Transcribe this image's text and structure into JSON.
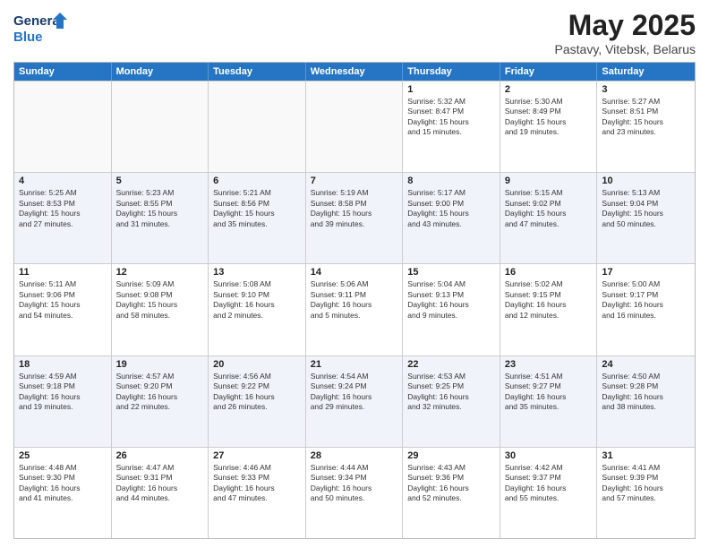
{
  "logo": {
    "line1": "General",
    "line2": "Blue"
  },
  "title": "May 2025",
  "subtitle": "Pastavy, Vitebsk, Belarus",
  "weekdays": [
    "Sunday",
    "Monday",
    "Tuesday",
    "Wednesday",
    "Thursday",
    "Friday",
    "Saturday"
  ],
  "rows": [
    [
      {
        "day": "",
        "text": "",
        "empty": true
      },
      {
        "day": "",
        "text": "",
        "empty": true
      },
      {
        "day": "",
        "text": "",
        "empty": true
      },
      {
        "day": "",
        "text": "",
        "empty": true
      },
      {
        "day": "1",
        "text": "Sunrise: 5:32 AM\nSunset: 8:47 PM\nDaylight: 15 hours\nand 15 minutes."
      },
      {
        "day": "2",
        "text": "Sunrise: 5:30 AM\nSunset: 8:49 PM\nDaylight: 15 hours\nand 19 minutes."
      },
      {
        "day": "3",
        "text": "Sunrise: 5:27 AM\nSunset: 8:51 PM\nDaylight: 15 hours\nand 23 minutes."
      }
    ],
    [
      {
        "day": "4",
        "text": "Sunrise: 5:25 AM\nSunset: 8:53 PM\nDaylight: 15 hours\nand 27 minutes."
      },
      {
        "day": "5",
        "text": "Sunrise: 5:23 AM\nSunset: 8:55 PM\nDaylight: 15 hours\nand 31 minutes."
      },
      {
        "day": "6",
        "text": "Sunrise: 5:21 AM\nSunset: 8:56 PM\nDaylight: 15 hours\nand 35 minutes."
      },
      {
        "day": "7",
        "text": "Sunrise: 5:19 AM\nSunset: 8:58 PM\nDaylight: 15 hours\nand 39 minutes."
      },
      {
        "day": "8",
        "text": "Sunrise: 5:17 AM\nSunset: 9:00 PM\nDaylight: 15 hours\nand 43 minutes."
      },
      {
        "day": "9",
        "text": "Sunrise: 5:15 AM\nSunset: 9:02 PM\nDaylight: 15 hours\nand 47 minutes."
      },
      {
        "day": "10",
        "text": "Sunrise: 5:13 AM\nSunset: 9:04 PM\nDaylight: 15 hours\nand 50 minutes."
      }
    ],
    [
      {
        "day": "11",
        "text": "Sunrise: 5:11 AM\nSunset: 9:06 PM\nDaylight: 15 hours\nand 54 minutes."
      },
      {
        "day": "12",
        "text": "Sunrise: 5:09 AM\nSunset: 9:08 PM\nDaylight: 15 hours\nand 58 minutes."
      },
      {
        "day": "13",
        "text": "Sunrise: 5:08 AM\nSunset: 9:10 PM\nDaylight: 16 hours\nand 2 minutes."
      },
      {
        "day": "14",
        "text": "Sunrise: 5:06 AM\nSunset: 9:11 PM\nDaylight: 16 hours\nand 5 minutes."
      },
      {
        "day": "15",
        "text": "Sunrise: 5:04 AM\nSunset: 9:13 PM\nDaylight: 16 hours\nand 9 minutes."
      },
      {
        "day": "16",
        "text": "Sunrise: 5:02 AM\nSunset: 9:15 PM\nDaylight: 16 hours\nand 12 minutes."
      },
      {
        "day": "17",
        "text": "Sunrise: 5:00 AM\nSunset: 9:17 PM\nDaylight: 16 hours\nand 16 minutes."
      }
    ],
    [
      {
        "day": "18",
        "text": "Sunrise: 4:59 AM\nSunset: 9:18 PM\nDaylight: 16 hours\nand 19 minutes."
      },
      {
        "day": "19",
        "text": "Sunrise: 4:57 AM\nSunset: 9:20 PM\nDaylight: 16 hours\nand 22 minutes."
      },
      {
        "day": "20",
        "text": "Sunrise: 4:56 AM\nSunset: 9:22 PM\nDaylight: 16 hours\nand 26 minutes."
      },
      {
        "day": "21",
        "text": "Sunrise: 4:54 AM\nSunset: 9:24 PM\nDaylight: 16 hours\nand 29 minutes."
      },
      {
        "day": "22",
        "text": "Sunrise: 4:53 AM\nSunset: 9:25 PM\nDaylight: 16 hours\nand 32 minutes."
      },
      {
        "day": "23",
        "text": "Sunrise: 4:51 AM\nSunset: 9:27 PM\nDaylight: 16 hours\nand 35 minutes."
      },
      {
        "day": "24",
        "text": "Sunrise: 4:50 AM\nSunset: 9:28 PM\nDaylight: 16 hours\nand 38 minutes."
      }
    ],
    [
      {
        "day": "25",
        "text": "Sunrise: 4:48 AM\nSunset: 9:30 PM\nDaylight: 16 hours\nand 41 minutes."
      },
      {
        "day": "26",
        "text": "Sunrise: 4:47 AM\nSunset: 9:31 PM\nDaylight: 16 hours\nand 44 minutes."
      },
      {
        "day": "27",
        "text": "Sunrise: 4:46 AM\nSunset: 9:33 PM\nDaylight: 16 hours\nand 47 minutes."
      },
      {
        "day": "28",
        "text": "Sunrise: 4:44 AM\nSunset: 9:34 PM\nDaylight: 16 hours\nand 50 minutes."
      },
      {
        "day": "29",
        "text": "Sunrise: 4:43 AM\nSunset: 9:36 PM\nDaylight: 16 hours\nand 52 minutes."
      },
      {
        "day": "30",
        "text": "Sunrise: 4:42 AM\nSunset: 9:37 PM\nDaylight: 16 hours\nand 55 minutes."
      },
      {
        "day": "31",
        "text": "Sunrise: 4:41 AM\nSunset: 9:39 PM\nDaylight: 16 hours\nand 57 minutes."
      }
    ]
  ]
}
